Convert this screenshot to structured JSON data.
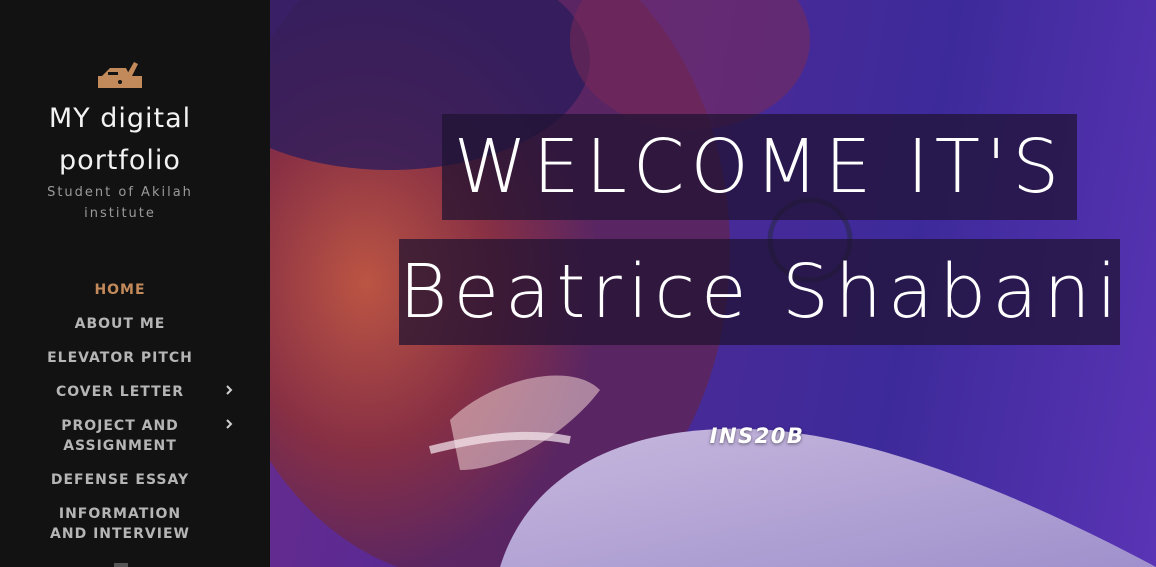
{
  "site": {
    "logo_icon": "hand-plane-icon",
    "title": "MY digital portfolio",
    "tagline": "Student of Akilah institute"
  },
  "nav": {
    "items": [
      {
        "label": "HOME",
        "active": true,
        "has_submenu": false
      },
      {
        "label": "ABOUT ME",
        "active": false,
        "has_submenu": false
      },
      {
        "label": "ELEVATOR PITCH",
        "active": false,
        "has_submenu": false
      },
      {
        "label": "COVER LETTER",
        "active": false,
        "has_submenu": true
      },
      {
        "label": "PROJECT AND ASSIGNMENT",
        "active": false,
        "has_submenu": true
      },
      {
        "label": "DEFENSE ESSAY",
        "active": false,
        "has_submenu": false
      },
      {
        "label": "INFORMATION AND INTERVIEW",
        "active": false,
        "has_submenu": false
      }
    ]
  },
  "hero": {
    "line1": "WELCOME IT'S",
    "line2": "Beatrice Shabani",
    "subtitle": "INS20B"
  },
  "colors": {
    "sidebar_bg": "#121212",
    "accent": "#c28a5b",
    "nav_text": "#b5b5b5",
    "hero_overlay": "#3d2a9a"
  }
}
